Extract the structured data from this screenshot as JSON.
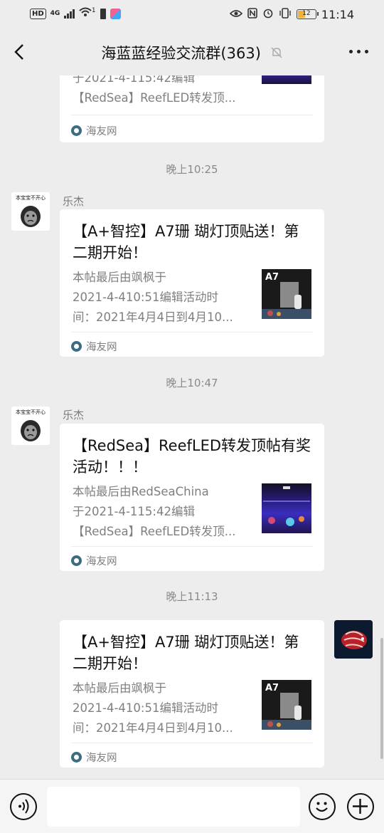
{
  "status_bar": {
    "network": "4G",
    "signal_sub": "1",
    "battery": "12",
    "time": "11:14"
  },
  "header": {
    "title": "海蓝蓝经验交流群(363)"
  },
  "messages": [
    {
      "desc": [
        "于2021-4-115:42编辑",
        "【RedSea】ReefLED转发顶..."
      ],
      "source": "海友网"
    },
    {
      "time": "晚上10:25",
      "sender": "乐杰",
      "title": "【A+智控】A7珊 瑚灯顶贴送！第二期开始！",
      "desc": [
        "本帖最后由飒枫于",
        "2021-4-410:51编辑活动时",
        "间：2021年4月4日到4月10..."
      ],
      "thumb_text": "A7",
      "source": "海友网"
    },
    {
      "time": "晚上10:47",
      "sender": "乐杰",
      "title": "【RedSea】ReefLED转发顶帖有奖活动！！！",
      "desc": [
        "本帖最后由RedSeaChina",
        "于2021-4-115:42编辑",
        "【RedSea】ReefLED转发顶..."
      ],
      "source": "海友网"
    },
    {
      "time": "晚上11:13",
      "title": "【A+智控】A7珊 瑚灯顶贴送！第二期开始！",
      "desc": [
        "本帖最后由飒枫于",
        "2021-4-410:51编辑活动时",
        "间：2021年4月4日到4月10..."
      ],
      "thumb_text": "A7",
      "source": "海友网"
    }
  ],
  "avatar_text": "本宝宝不开心",
  "icons": {
    "back": "chevron-left-icon",
    "mute": "bell-off-icon",
    "more": "more-dots-icon",
    "voice": "voice-icon",
    "emoji": "emoji-icon",
    "plus": "plus-icon"
  }
}
